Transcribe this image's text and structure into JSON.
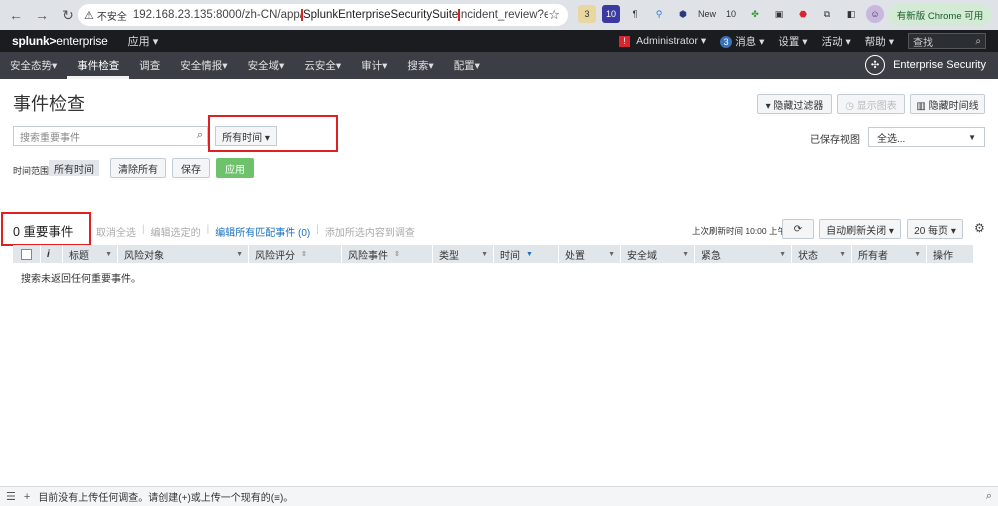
{
  "browser": {
    "insecure_label": "不安全",
    "url_prefix": "192.168.23.135:8000/zh-CN/app/",
    "url_highlight": "SplunkEnterpriseSecuritySuite",
    "url_suffix": "incident_review?earliest=0&l...",
    "update_label": "有新版 Chrome 可用",
    "ext_badges": [
      "3",
      "10",
      "New",
      "10"
    ]
  },
  "header": {
    "logo_main": "splunk>",
    "logo_sub": "enterprise",
    "app_menu": "应用 ▾",
    "alert_icon_text": "!",
    "user": "Administrator ▾",
    "messages_count": "3",
    "messages": "消息 ▾",
    "settings": "设置 ▾",
    "activity": "活动 ▾",
    "help": "帮助 ▾",
    "search_label": "查找"
  },
  "nav": {
    "items": [
      "安全态势▾",
      "事件检查",
      "调查",
      "安全情报▾",
      "安全域▾",
      "云安全▾",
      "审计▾",
      "搜索▾",
      "配置▾"
    ],
    "active_index": 1,
    "brand": "Enterprise Security"
  },
  "page": {
    "title": "事件检查",
    "hide_filters": "▾ 隐藏过滤器",
    "show_chart": "◷ 显示图表",
    "hide_timeline": "▥ 隐藏时间线",
    "search_placeholder": "搜索重要事件",
    "time_dropdown": "所有时间 ▾",
    "saved_view_label": "已保存视图",
    "saved_view_value": "全选...",
    "time_range_label": "时间范围:",
    "time_range_value": "所有时间",
    "clear_all": "清除所有",
    "save": "保存",
    "apply": "应用"
  },
  "results": {
    "count_title": "0 重要事件",
    "deselect_all": "取消全选",
    "edit_selected": "编辑选定的",
    "edit_all_matching": "编辑所有匹配事件 (0)",
    "add_to_investigation": "添加所选内容到调查",
    "last_refresh": "上次刷新时间 10:00 上午",
    "auto_refresh": "自动刷新关闭 ▾",
    "per_page": "20 每页 ▾"
  },
  "table": {
    "columns": [
      "i",
      "标题",
      "风险对象",
      "风险评分",
      "风险事件",
      "类型",
      "时间",
      "处置",
      "安全域",
      "紧急",
      "状态",
      "所有者",
      "操作"
    ],
    "empty_message": "搜索未返回任何重要事件。"
  },
  "footer": {
    "message": "目前没有上传任何调查。请创建(+)或上传一个现有的(≡)。"
  }
}
